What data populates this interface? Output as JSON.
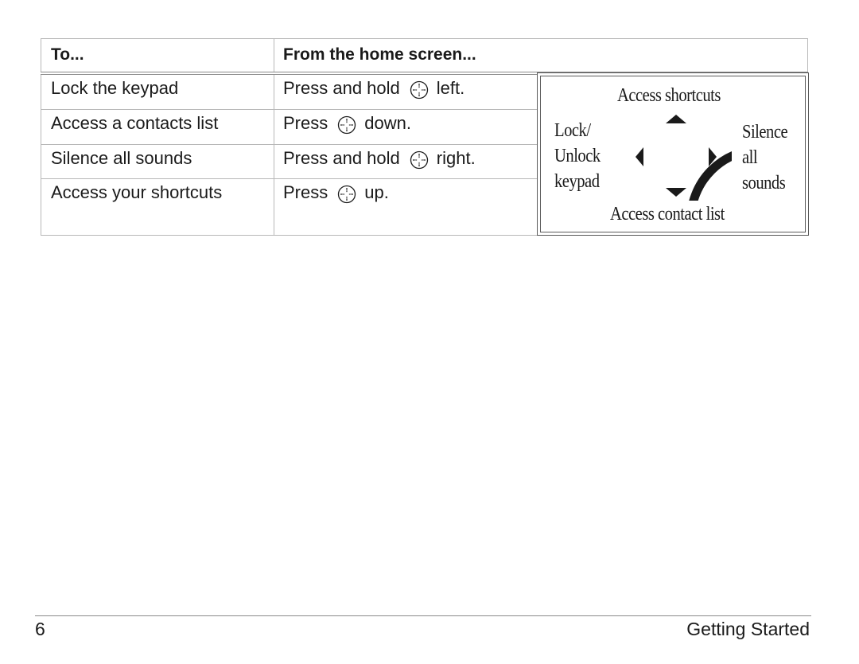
{
  "table": {
    "headers": [
      "To...",
      "From the home screen..."
    ],
    "rows": [
      {
        "action": "Lock the keypad",
        "before": "Press and hold",
        "icon": "nav-key-icon",
        "after": "left."
      },
      {
        "action": "Access a contacts list",
        "before": "Press",
        "icon": "nav-key-icon",
        "after": "down."
      },
      {
        "action": "Silence all sounds",
        "before": "Press and hold",
        "icon": "nav-key-icon",
        "after": "right."
      },
      {
        "action": "Access your shortcuts",
        "before": "Press",
        "icon": "nav-key-icon",
        "after": "up."
      }
    ]
  },
  "diagram": {
    "up": "Access shortcuts",
    "down": "Access contact list",
    "left": [
      "Lock/",
      "Unlock",
      "keypad"
    ],
    "right": [
      "Silence",
      "all",
      "sounds"
    ],
    "icons": [
      "arrow-up-icon",
      "arrow-down-icon",
      "arrow-left-icon",
      "arrow-right-icon",
      "nav-key-icon"
    ]
  },
  "footer": {
    "page_number": "6",
    "section_title": "Getting Started"
  }
}
